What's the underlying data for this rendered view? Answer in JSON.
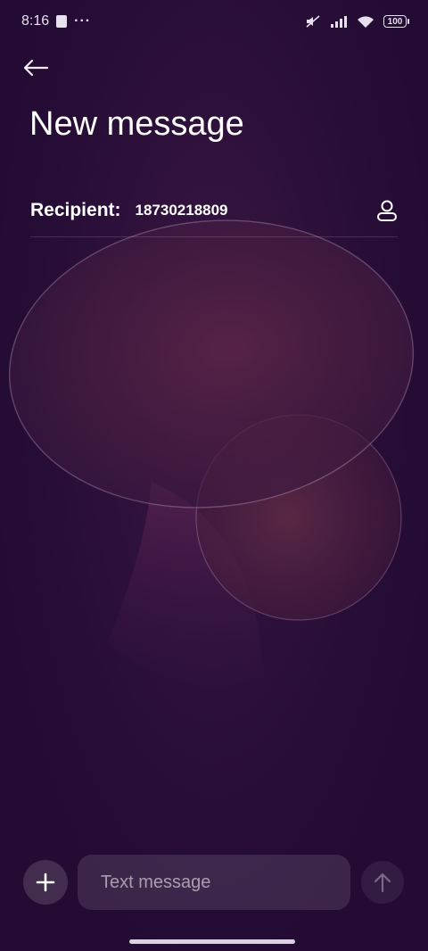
{
  "status_bar": {
    "time": "8:16",
    "more": "···",
    "battery": "100"
  },
  "header": {
    "title": "New message"
  },
  "recipient": {
    "label": "Recipient:",
    "value": "18730218809"
  },
  "composer": {
    "placeholder": "Text message"
  },
  "colors": {
    "background": "#230b33",
    "accent_shape": "#5a2a45"
  }
}
